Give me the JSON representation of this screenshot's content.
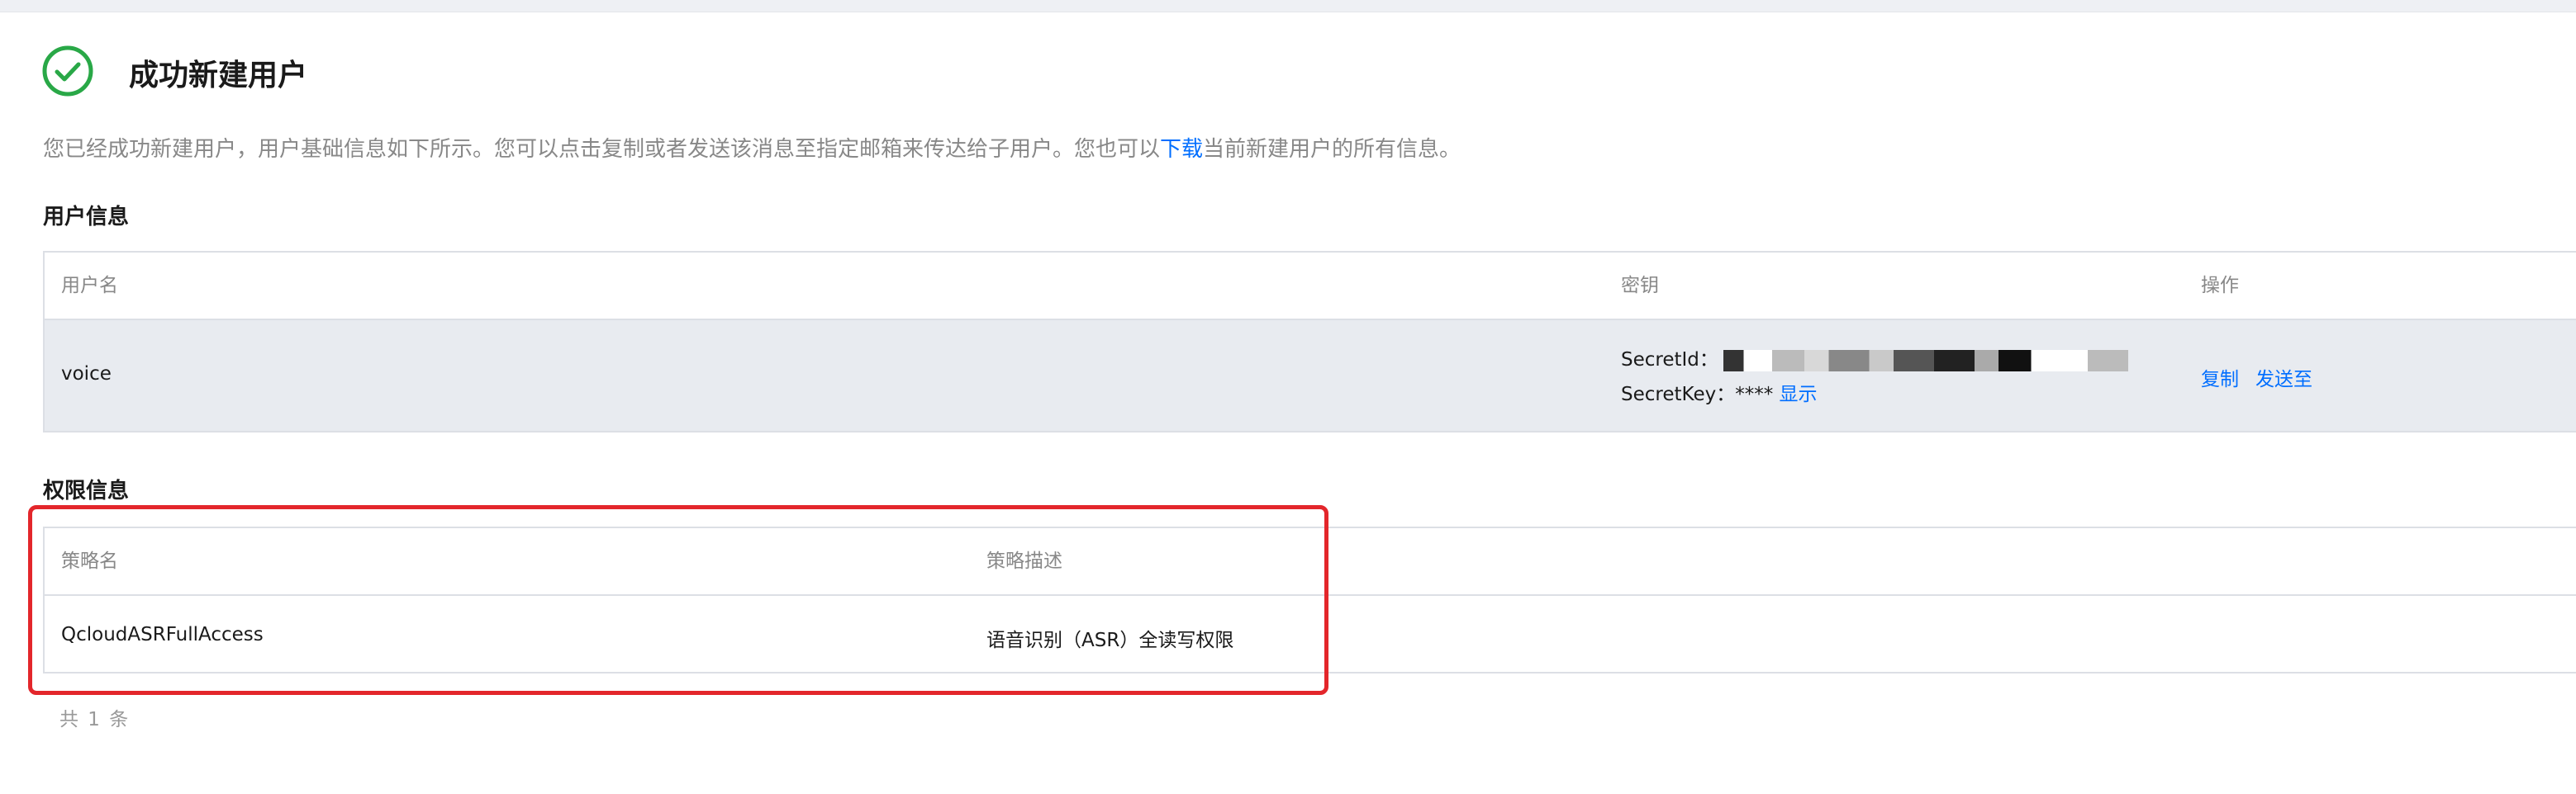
{
  "header": {
    "title": "成功新建用户",
    "description_prefix": "您已经成功新建用户，用户基础信息如下所示。您可以点击复制或者发送该消息至指定邮箱来传达给子用户。您也可以",
    "download_link": "下载",
    "description_suffix": "当前新建用户的所有信息。"
  },
  "user_info": {
    "section_title": "用户信息",
    "columns": [
      "用户名",
      "密钥",
      "操作"
    ],
    "row": {
      "username": "voice",
      "secret_id_label": "SecretId：",
      "secret_id_value_visible": "AKID...",
      "secret_key_label": "SecretKey：",
      "secret_key_value": "****",
      "show_label": "显示",
      "copy_label": "复制",
      "send_label": "发送至"
    }
  },
  "permission_info": {
    "section_title": "权限信息",
    "columns": [
      "策略名",
      "策略描述"
    ],
    "rows": [
      {
        "name": "QcloudASRFullAccess",
        "description": "语音识别（ASR）全读写权限"
      }
    ],
    "total_text": "共 1 条"
  },
  "colors": {
    "success": "#29a847",
    "link": "#006eff",
    "highlight_box": "#e3262b",
    "row_hover": "#e8ebf0"
  }
}
